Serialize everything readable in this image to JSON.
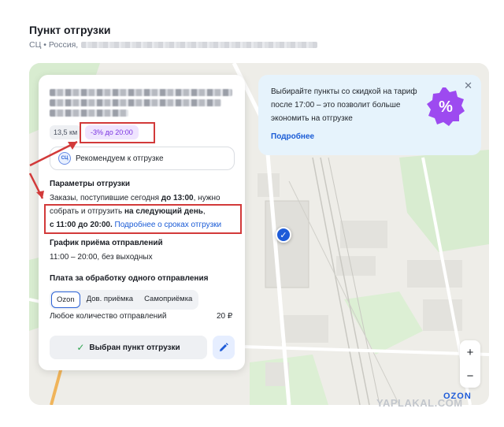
{
  "page": {
    "title": "Пункт отгрузки",
    "subtitle_prefix": "СЦ • Россия,"
  },
  "card": {
    "distance_chip": "13,5 км",
    "discount_chip": "-3% до 20:00",
    "recommend_label": "Рекомендуем к отгрузке",
    "sc_badge": "СЦ",
    "params_title": "Параметры отгрузки",
    "params_text_1": "Заказы, поступившие сегодня ",
    "params_bold_1": "до 13:00",
    "params_text_2": ", нужно",
    "params_text_3": "собрать и отгрузить ",
    "params_bold_2": "на следующий день",
    "params_text_4": ",",
    "params_bold_3": "с 11:00 до 20:00.",
    "params_link": "Подробнее о сроках отгрузки",
    "schedule_title": "График приёма отправлений",
    "schedule_text": "11:00 – 20:00, без выходных",
    "fee_title": "Плата за обработку одного отправления",
    "fee_tabs": [
      "Ozon",
      "Дов. приёмка",
      "Самоприёмка"
    ],
    "fee_active": "Ozon",
    "fee_row_label": "Любое количество отправлений",
    "fee_row_value": "20 ₽",
    "select_button": "Выбран пункт отгрузки"
  },
  "promo": {
    "text": "Выбирайте пункты со скидкой на тариф после 17:00 – это позволит больше экономить на отгрузке",
    "link": "Подробнее",
    "badge_symbol": "%"
  },
  "map": {
    "zoom_in": "+",
    "zoom_out": "−",
    "logo": "OZON"
  },
  "watermark": "YAPLAKAL.COM",
  "colors": {
    "accent": "#1e5bd8",
    "highlight": "#d23a3a",
    "promo_bg": "#e6f3fc",
    "discount": "#7a33e0"
  }
}
